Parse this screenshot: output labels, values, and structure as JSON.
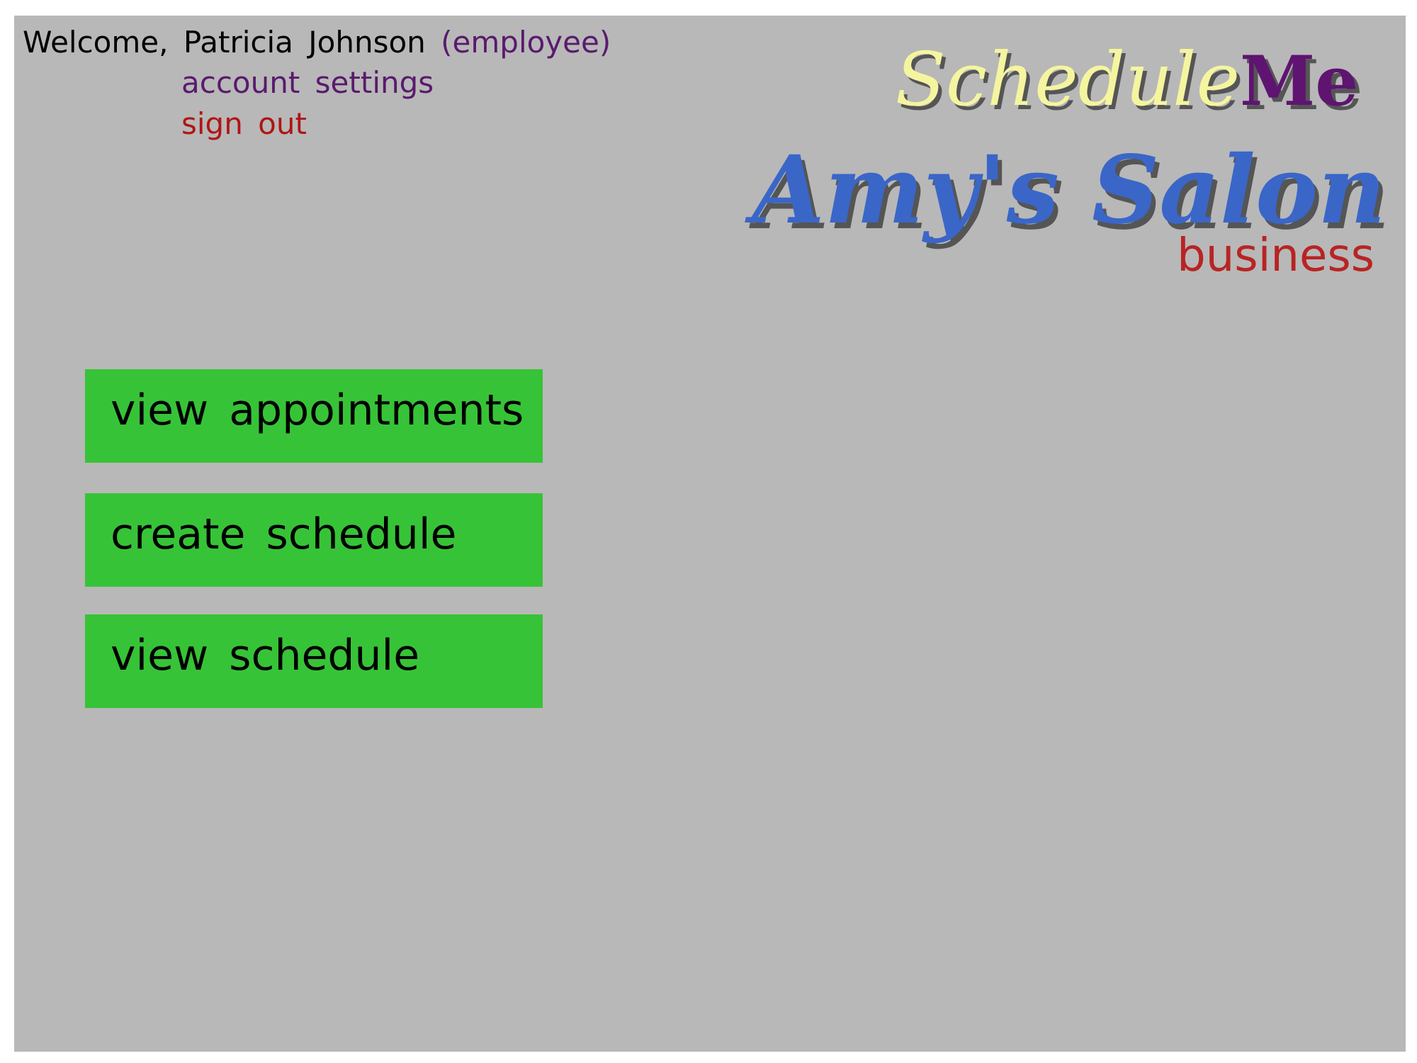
{
  "header": {
    "welcome_prefix": "Welcome, Patricia Johnson",
    "role": "(employee)",
    "account_settings_label": "account settings",
    "sign_out_label": "sign out"
  },
  "logo": {
    "app_name_part1": "Schedule",
    "app_name_part2": "Me",
    "business_name": "Amy's Salon",
    "account_type": "business"
  },
  "menu": {
    "items": [
      {
        "label": "view appointments"
      },
      {
        "label": "create schedule"
      },
      {
        "label": "view schedule"
      }
    ]
  },
  "colors": {
    "background": "#b8b8b8",
    "button": "#37c337",
    "link_purple": "#5a1a6e",
    "link_red": "#b01515",
    "logo_yellow": "#f5f5a0",
    "logo_purple": "#5e1470",
    "logo_blue": "#3a66c8",
    "business_red": "#b82424"
  }
}
